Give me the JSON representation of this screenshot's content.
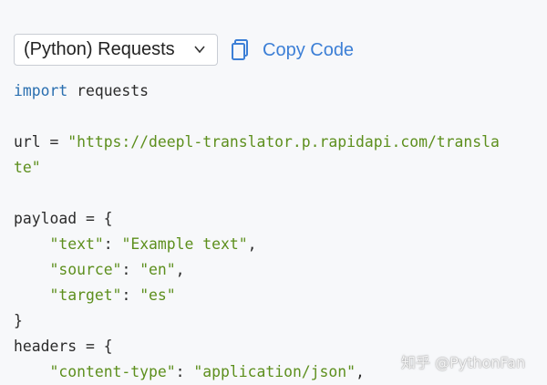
{
  "toolbar": {
    "language_selector": {
      "selected": "(Python) Requests",
      "chevron_icon": "chevron-down-icon"
    },
    "copy_button": {
      "icon": "copy-icon",
      "label": "Copy Code",
      "color": "#3c7fd6"
    }
  },
  "code": {
    "colors": {
      "keyword": "#2a6fb0",
      "string": "#5d8f1d",
      "text": "#2b2b2b"
    },
    "lines": [
      [
        {
          "t": "kw",
          "v": "import"
        },
        {
          "t": "plain",
          "v": " requests"
        }
      ],
      [],
      [
        {
          "t": "plain",
          "v": "url = "
        },
        {
          "t": "str",
          "v": "\"https://deepl-translator.p.rapidapi.com/transla"
        }
      ],
      [
        {
          "t": "str",
          "v": "te\""
        }
      ],
      [],
      [
        {
          "t": "plain",
          "v": "payload = {"
        }
      ],
      [
        {
          "t": "plain",
          "v": "    "
        },
        {
          "t": "str",
          "v": "\"text\""
        },
        {
          "t": "plain",
          "v": ": "
        },
        {
          "t": "str",
          "v": "\"Example text\""
        },
        {
          "t": "plain",
          "v": ","
        }
      ],
      [
        {
          "t": "plain",
          "v": "    "
        },
        {
          "t": "str",
          "v": "\"source\""
        },
        {
          "t": "plain",
          "v": ": "
        },
        {
          "t": "str",
          "v": "\"en\""
        },
        {
          "t": "plain",
          "v": ","
        }
      ],
      [
        {
          "t": "plain",
          "v": "    "
        },
        {
          "t": "str",
          "v": "\"target\""
        },
        {
          "t": "plain",
          "v": ": "
        },
        {
          "t": "str",
          "v": "\"es\""
        }
      ],
      [
        {
          "t": "plain",
          "v": "}"
        }
      ],
      [
        {
          "t": "plain",
          "v": "headers = {"
        }
      ],
      [
        {
          "t": "plain",
          "v": "    "
        },
        {
          "t": "str",
          "v": "\"content-type\""
        },
        {
          "t": "plain",
          "v": ": "
        },
        {
          "t": "str",
          "v": "\"application/json\""
        },
        {
          "t": "plain",
          "v": ","
        }
      ]
    ]
  },
  "watermark": {
    "text": "知乎 @PythonFan"
  }
}
